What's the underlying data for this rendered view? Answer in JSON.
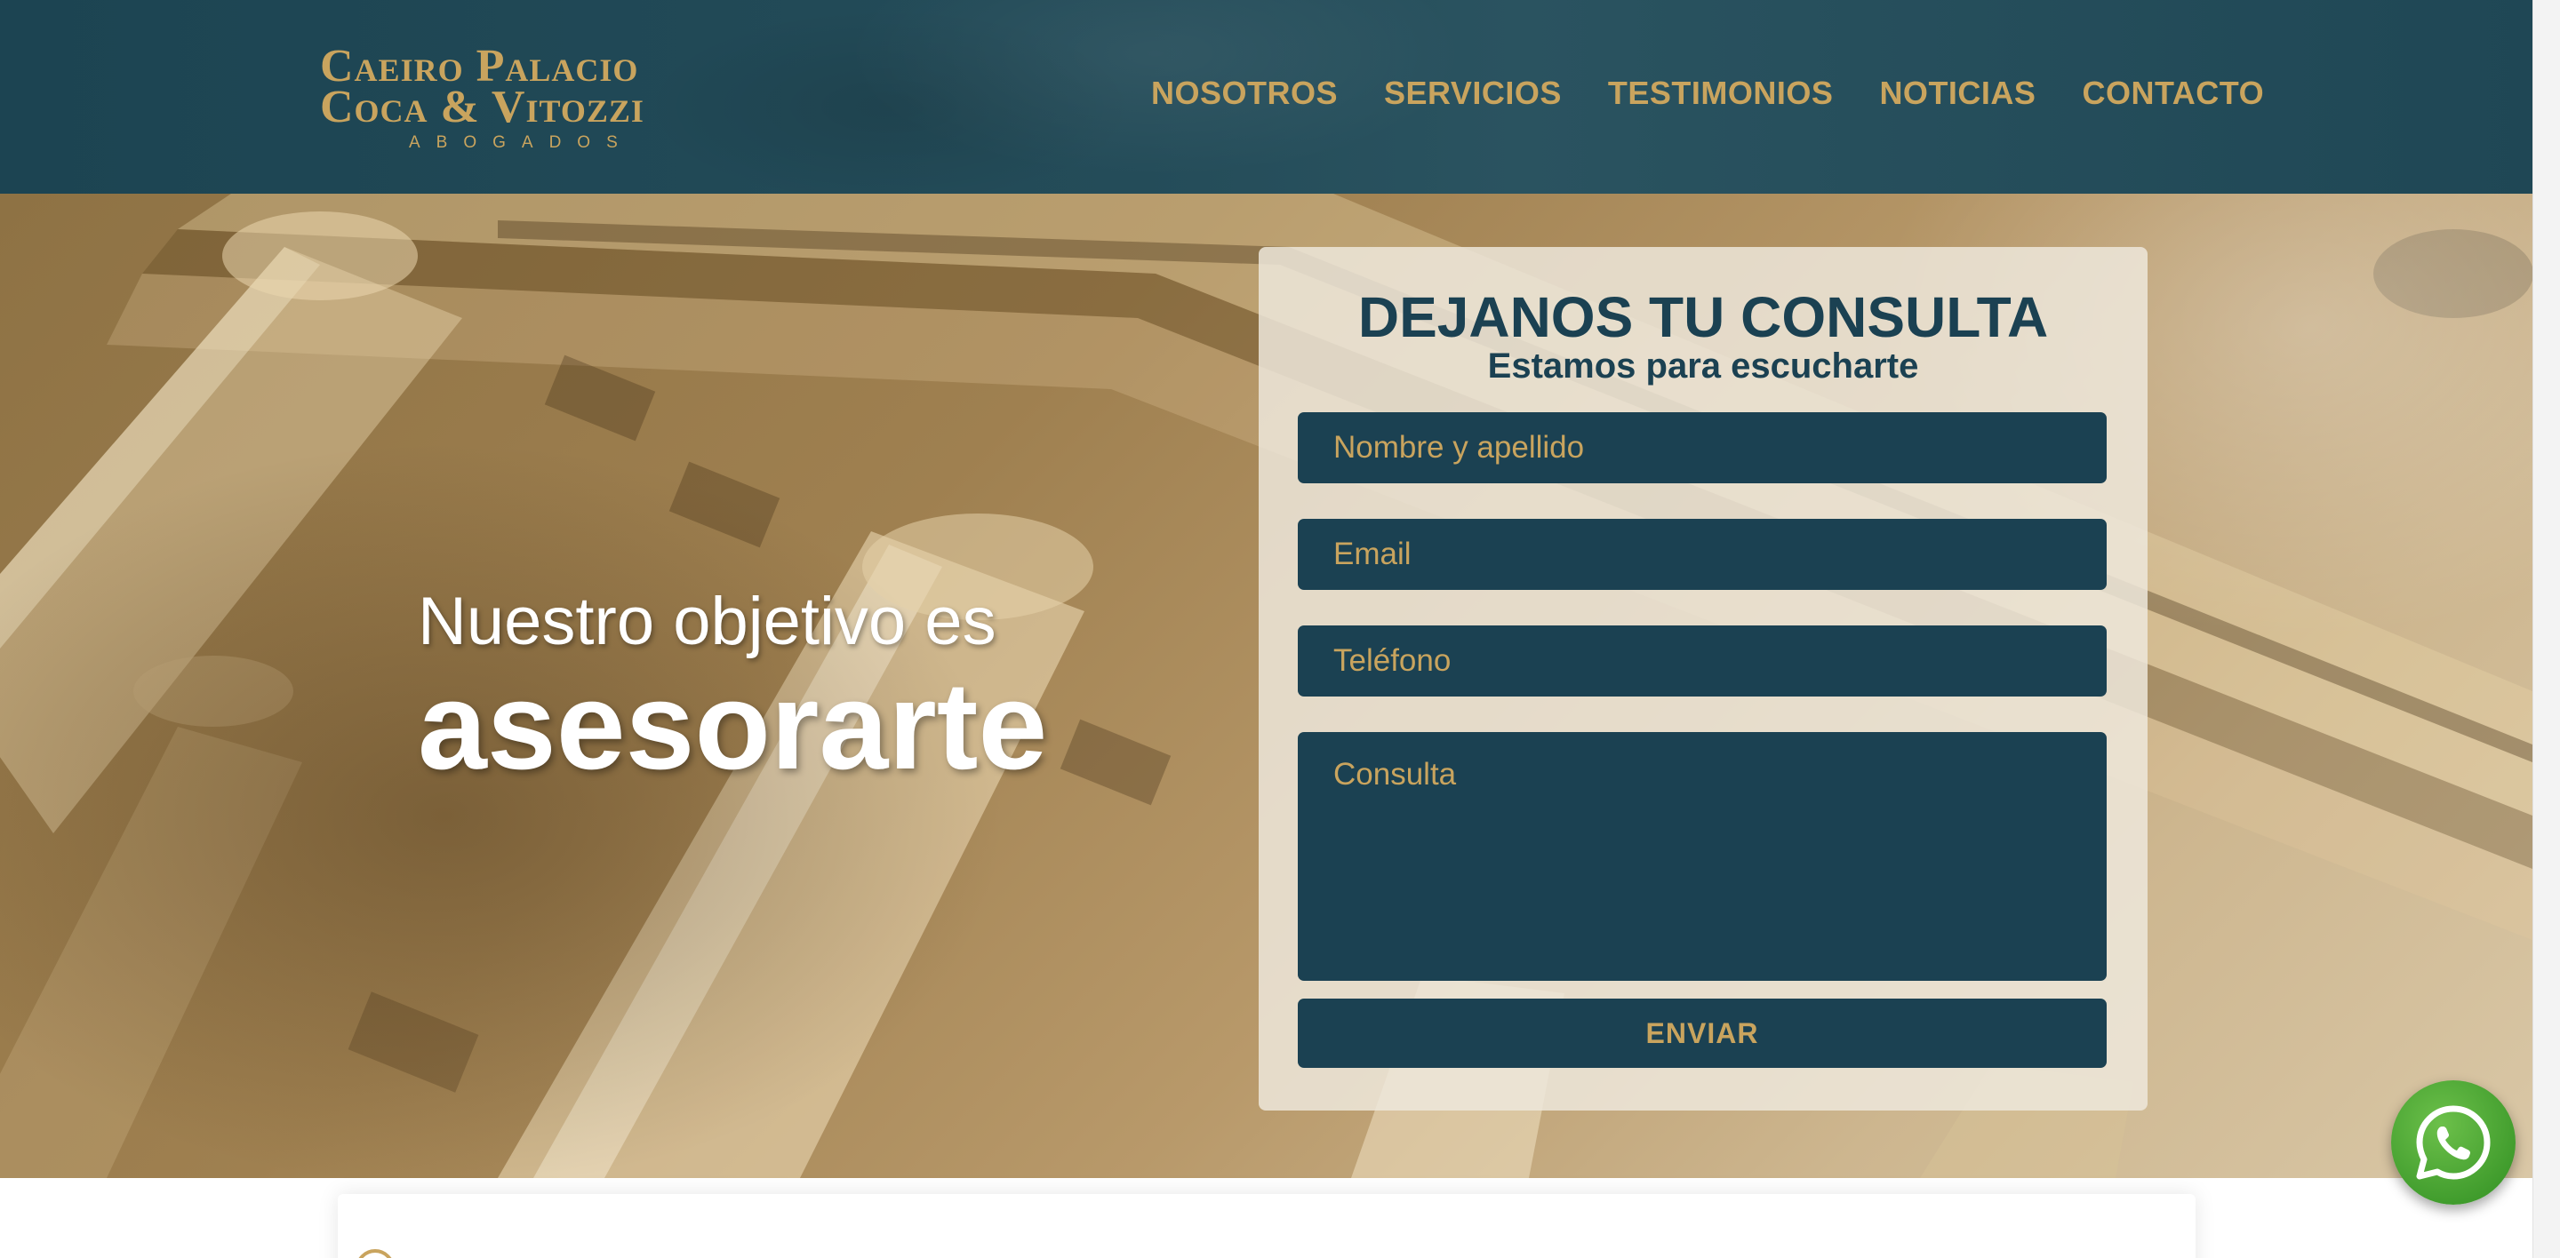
{
  "header": {
    "logo": {
      "line1": "Caeiro Palacio",
      "line2": "Coca & Vitozzi",
      "subtitle": "ABOGADOS"
    },
    "nav": [
      {
        "label": "NOSOTROS"
      },
      {
        "label": "SERVICIOS"
      },
      {
        "label": "TESTIMONIOS"
      },
      {
        "label": "NOTICIAS"
      },
      {
        "label": "CONTACTO"
      }
    ]
  },
  "hero": {
    "tagline_small": "Nuestro objetivo es",
    "tagline_big": "asesorarte"
  },
  "contact_form": {
    "title": "DEJANOS TU CONSULTA",
    "subtitle": "Estamos para escucharte",
    "name_placeholder": "Nombre y apellido",
    "email_placeholder": "Email",
    "phone_placeholder": "Teléfono",
    "message_placeholder": "Consulta",
    "submit_label": "ENVIAR"
  },
  "floating": {
    "whatsapp_icon": "whatsapp-icon"
  },
  "colors": {
    "navy": "#1b4152",
    "gold": "#c9a45e",
    "whatsapp_green": "#4caf3a"
  }
}
